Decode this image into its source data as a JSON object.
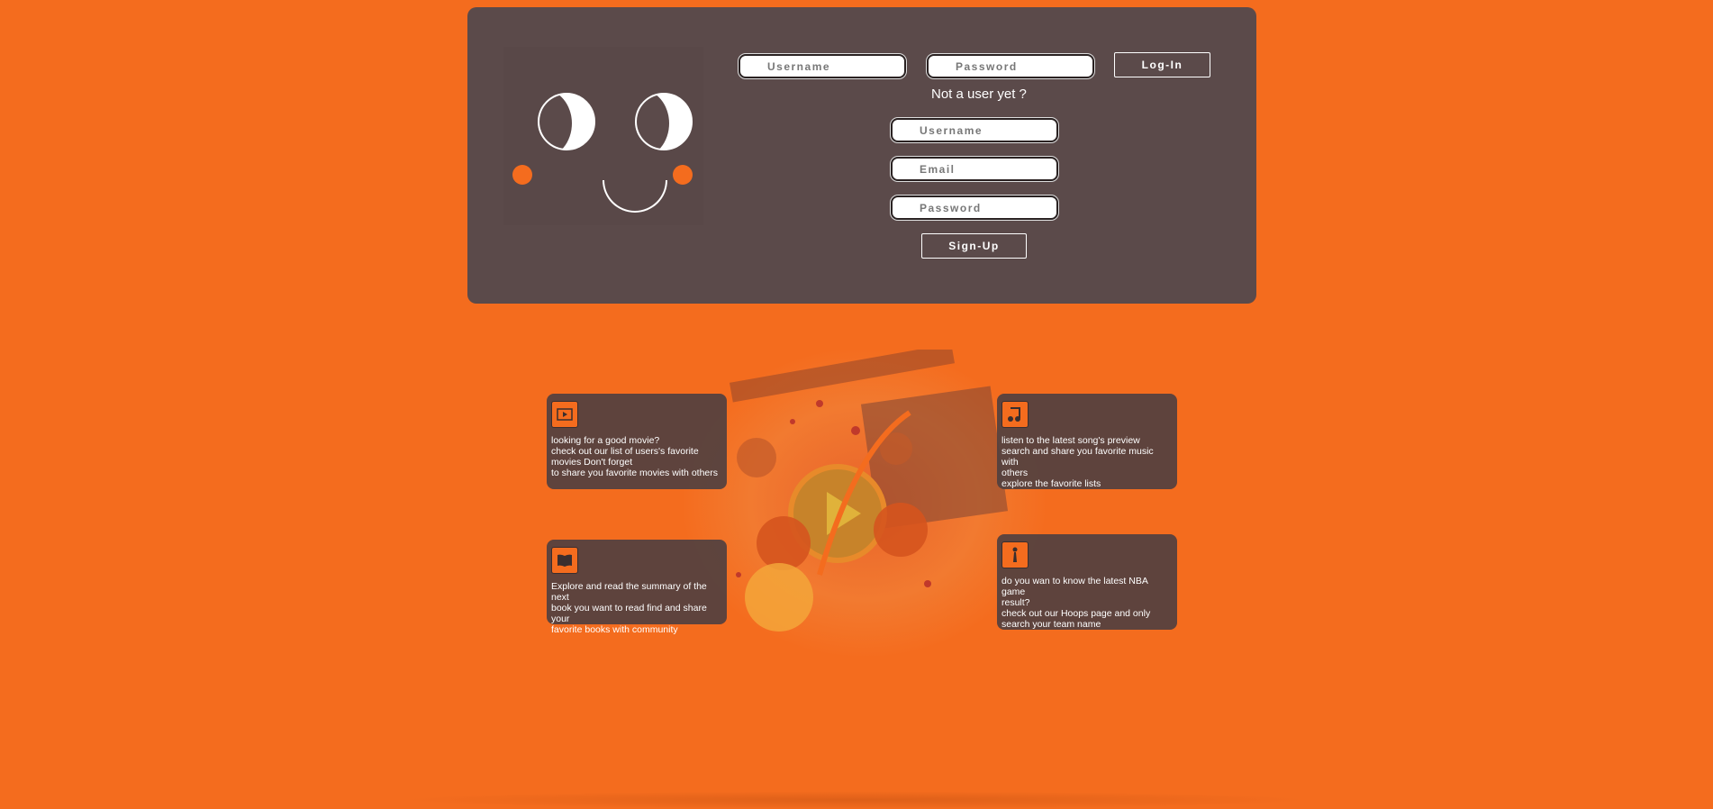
{
  "login": {
    "username_placeholder": "Username",
    "password_placeholder": "Password",
    "login_label": "Log-In"
  },
  "signup": {
    "prompt": "Not a user yet ?",
    "username_placeholder": "Username",
    "email_placeholder": "Email",
    "password_placeholder": "Password",
    "signup_label": "Sign-Up"
  },
  "features": {
    "movies": {
      "icon": "movie-icon",
      "lines": [
        "looking for a good movie?",
        "check out our list of users's favorite",
        "movies Don't forget",
        "to share you favorite movies with others"
      ]
    },
    "music": {
      "icon": "music-icon",
      "lines": [
        "listen to the latest song's preview",
        "search and share you favorite music with",
        "others",
        "explore the favorite lists"
      ]
    },
    "books": {
      "icon": "book-icon",
      "lines": [
        "Explore and read the summary of the next",
        "book you want to read find and share your",
        "favorite books with community"
      ]
    },
    "nba": {
      "icon": "basketball-icon",
      "lines": [
        "do you wan to know the latest NBA game",
        "result?",
        "check out our Hoops page and only",
        "search your team name"
      ]
    }
  },
  "colors": {
    "background": "#f46c1e",
    "panel": "#5b4a4a",
    "card": "#504040",
    "text": "#ffffff"
  }
}
